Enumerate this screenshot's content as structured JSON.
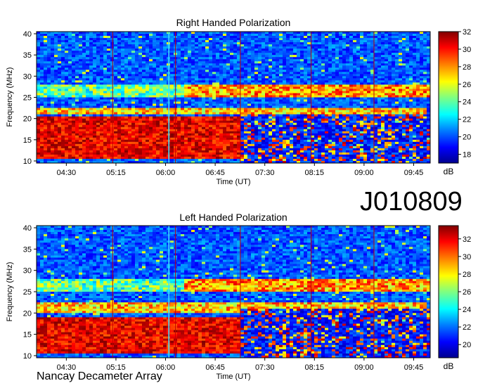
{
  "observation_id": "J010809",
  "instrument": "Nancay Decameter Array",
  "colors": {
    "colormap": [
      "#00008f",
      "#0000ff",
      "#0080ff",
      "#00ffff",
      "#80ff80",
      "#ffff00",
      "#ff8000",
      "#ff0000",
      "#800000"
    ]
  },
  "chart_data": [
    {
      "type": "heatmap",
      "title": "Right Handed Polarization",
      "xlabel": "Time (UT)",
      "ylabel": "Frequency (MHz)",
      "x_ticks": [
        "04:30",
        "05:15",
        "06:00",
        "06:45",
        "07:30",
        "08:15",
        "09:00",
        "09:45"
      ],
      "x_tick_hours": [
        4.5,
        5.25,
        6.0,
        6.75,
        7.5,
        8.25,
        9.0,
        9.75
      ],
      "xlim_hours": [
        4.05,
        10.0
      ],
      "y_ticks": [
        10,
        15,
        20,
        25,
        30,
        35,
        40
      ],
      "ylim": [
        9.5,
        40.5
      ],
      "colorbar": {
        "label": "dB",
        "ticks": [
          18,
          20,
          22,
          24,
          26,
          28,
          30,
          32
        ],
        "range": [
          17,
          32
        ]
      },
      "emission_bands_mhz": [
        [
          10.5,
          20.5
        ],
        [
          21,
          22.5
        ],
        [
          25,
          28
        ]
      ],
      "emission_end_hours": [
        7.12,
        9.95,
        10.0
      ],
      "vertical_markers_hours": [
        5.2,
        6.05,
        6.15,
        7.13,
        8.2,
        9.15
      ]
    },
    {
      "type": "heatmap",
      "title": "Left Handed Polarization",
      "xlabel": "Time (UT)",
      "ylabel": "Frequency (MHz)",
      "x_ticks": [
        "04:30",
        "05:15",
        "06:00",
        "06:45",
        "07:30",
        "08:15",
        "09:00",
        "09:45"
      ],
      "x_tick_hours": [
        4.5,
        5.25,
        6.0,
        6.75,
        7.5,
        8.25,
        9.0,
        9.75
      ],
      "xlim_hours": [
        4.05,
        10.0
      ],
      "y_ticks": [
        10,
        15,
        20,
        25,
        30,
        35,
        40
      ],
      "ylim": [
        9.5,
        40.5
      ],
      "colorbar": {
        "label": "dB",
        "ticks": [
          20,
          22,
          24,
          26,
          28,
          30,
          32
        ],
        "range": [
          18.5,
          33.5
        ]
      },
      "emission_bands_mhz": [
        [
          10.5,
          19
        ],
        [
          20,
          22.5
        ],
        [
          25,
          28
        ]
      ],
      "emission_end_hours": [
        7.12,
        9.95,
        10.0
      ],
      "vertical_markers_hours": [
        5.2,
        6.05,
        6.15,
        7.13,
        8.2,
        9.15
      ]
    }
  ]
}
